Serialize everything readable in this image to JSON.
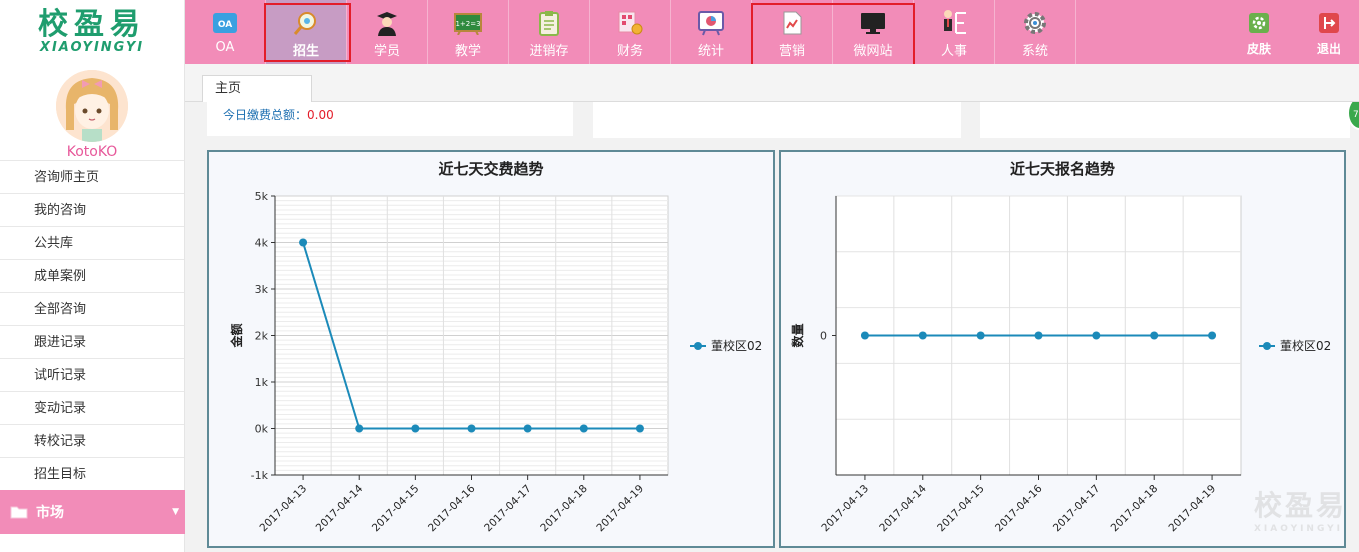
{
  "brand": {
    "name_cn": "校盈易",
    "name_en": "XIAOYINGYI"
  },
  "user": {
    "name": "KotoKO"
  },
  "topnav": {
    "items": [
      {
        "label": "OA",
        "icon": "oa-icon"
      },
      {
        "label": "招生",
        "icon": "search-magnifier-icon",
        "active": true
      },
      {
        "label": "学员",
        "icon": "graduate-icon"
      },
      {
        "label": "教学",
        "icon": "blackboard-icon"
      },
      {
        "label": "进销存",
        "icon": "clipboard-icon"
      },
      {
        "label": "财务",
        "icon": "finance-coins-icon"
      },
      {
        "label": "统计",
        "icon": "statistics-board-icon"
      },
      {
        "label": "营销",
        "icon": "marketing-doc-icon"
      },
      {
        "label": "微网站",
        "icon": "monitor-icon"
      },
      {
        "label": "人事",
        "icon": "person-org-icon"
      },
      {
        "label": "系统",
        "icon": "gear-icon"
      }
    ],
    "skin_label": "皮肤",
    "logout_label": "退出"
  },
  "sidebar": {
    "items": [
      {
        "label": "咨询师主页"
      },
      {
        "label": "我的咨询"
      },
      {
        "label": "公共库"
      },
      {
        "label": "成单案例"
      },
      {
        "label": "全部咨询"
      },
      {
        "label": "跟进记录"
      },
      {
        "label": "试听记录"
      },
      {
        "label": "变动记录"
      },
      {
        "label": "转校记录"
      },
      {
        "label": "招生目标"
      }
    ],
    "group_label": "市场"
  },
  "tabs": {
    "home": "主页"
  },
  "summary": {
    "label": "今日缴费总额：",
    "value": "0.00"
  },
  "side_badge": "7",
  "chart_data": [
    {
      "type": "line",
      "title": "近七天交费趋势",
      "ylabel": "金额",
      "xlabel": "",
      "categories": [
        "2017-04-13",
        "2017-04-14",
        "2017-04-15",
        "2017-04-16",
        "2017-04-17",
        "2017-04-18",
        "2017-04-19"
      ],
      "series": [
        {
          "name": "董校区02",
          "values": [
            4000,
            0,
            0,
            0,
            0,
            0,
            0
          ],
          "color": "#1b8ab9"
        }
      ],
      "ylim": [
        -1000,
        5000
      ],
      "yticks": [
        "-1k",
        "0k",
        "1k",
        "2k",
        "3k",
        "4k",
        "5k"
      ],
      "grid": true,
      "legend": "right"
    },
    {
      "type": "line",
      "title": "近七天报名趋势",
      "ylabel": "数量",
      "xlabel": "",
      "categories": [
        "2017-04-13",
        "2017-04-14",
        "2017-04-15",
        "2017-04-16",
        "2017-04-17",
        "2017-04-18",
        "2017-04-19"
      ],
      "series": [
        {
          "name": "董校区02",
          "values": [
            0,
            0,
            0,
            0,
            0,
            0,
            0
          ],
          "color": "#1b8ab9"
        }
      ],
      "yticks": [
        "0"
      ],
      "grid": true,
      "legend": "right"
    }
  ],
  "colors": {
    "nav_bg": "#f28cb8",
    "brand_green": "#1f9d6e",
    "highlight_red": "#e31d2a",
    "series": "#1b8ab9"
  }
}
